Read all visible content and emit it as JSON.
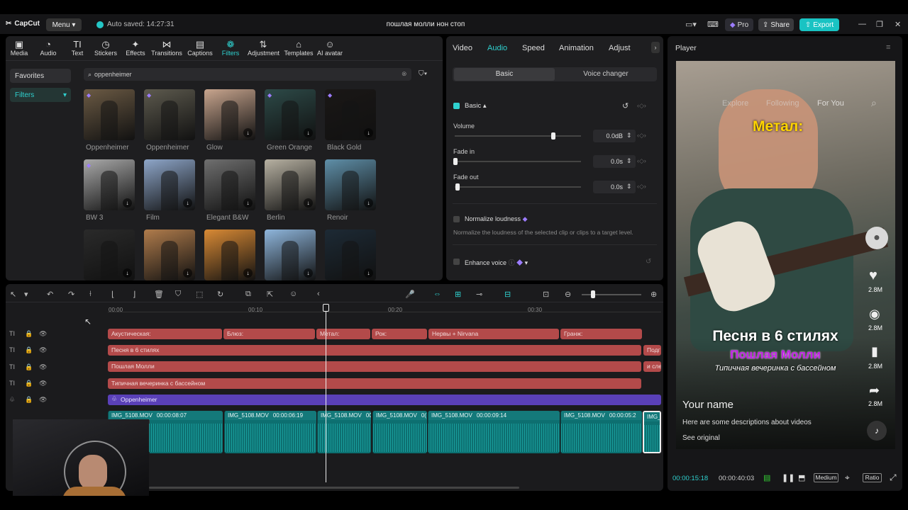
{
  "app": {
    "logo": "CapCut",
    "menu": "Menu",
    "autosave": "Auto saved: 14:27:31",
    "title": "пошлая молли нон стоп",
    "pro": "Pro",
    "share": "Share",
    "export": "Export"
  },
  "toolbar": [
    {
      "label": "Media",
      "icon": "▣"
    },
    {
      "label": "Audio",
      "icon": "◔"
    },
    {
      "label": "Text",
      "icon": "TI"
    },
    {
      "label": "Stickers",
      "icon": "◷"
    },
    {
      "label": "Effects",
      "icon": "✦"
    },
    {
      "label": "Transitions",
      "icon": "⋈"
    },
    {
      "label": "Captions",
      "icon": "▤"
    },
    {
      "label": "Filters",
      "icon": "❁"
    },
    {
      "label": "Adjustment",
      "icon": "⇅"
    },
    {
      "label": "Templates",
      "icon": "⌂"
    },
    {
      "label": "AI avatar",
      "icon": "☺"
    }
  ],
  "sidebar": {
    "favorites": "Favorites",
    "filters": "Filters"
  },
  "search": {
    "value": "oppenheimer"
  },
  "filters": [
    {
      "name": "Oppenheimer",
      "bg": "#6b5a44"
    },
    {
      "name": "Oppenheimer",
      "bg": "#5d5a4e"
    },
    {
      "name": "Glow",
      "bg": "#c8a58e"
    },
    {
      "name": "Green Orange",
      "bg": "#2d4a48"
    },
    {
      "name": "Black Gold",
      "bg": "#1a1716"
    },
    {
      "name": "BW 3",
      "bg": "#a9a9a9"
    },
    {
      "name": "Film",
      "bg": "#8ea6c9"
    },
    {
      "name": "Elegant B&W",
      "bg": "#6f6f6f"
    },
    {
      "name": "Berlin",
      "bg": "#b7b1a2"
    },
    {
      "name": "Renoir",
      "bg": "#5f8fa8"
    },
    {
      "name": "",
      "bg": "#2a2a2a"
    },
    {
      "name": "",
      "bg": "#b07c4c"
    },
    {
      "name": "",
      "bg": "#d98a35"
    },
    {
      "name": "",
      "bg": "#8fb6dc"
    },
    {
      "name": "",
      "bg": "#1d2a35"
    }
  ],
  "props": {
    "tabs": [
      "Video",
      "Audio",
      "Speed",
      "Animation",
      "Adjust"
    ],
    "subtabs": [
      "Basic",
      "Voice changer"
    ],
    "section": "Basic",
    "volume_label": "Volume",
    "volume_value": "0.0dB",
    "volume_level": 0.78,
    "fadein_label": "Fade in",
    "fadein_value": "0.0s",
    "fadeout_label": "Fade out",
    "fadeout_value": "0.0s",
    "normalize_label": "Normalize loudness",
    "normalize_desc": "Normalize the loudness of the selected clip or clips to a target level.",
    "enhance_label": "Enhance voice"
  },
  "timeline": {
    "ruler": [
      "00:00",
      "00:10",
      "00:20",
      "00:30"
    ],
    "row1": [
      "Акустическая:",
      "Блюз:",
      "Метал:",
      "Рок:",
      "Нервы + Nirvana",
      "Гранж:"
    ],
    "row2": "Песня в 6 стилях",
    "row2_tail": "Подг",
    "row3": "Пошлая Молли",
    "row3_tail": "и сле",
    "row4": "Типичная вечеринка с бассейном",
    "row5": "Oppenheimer",
    "video": [
      {
        "name": "IMG_5108.MOV",
        "dur": "00:00:08:07"
      },
      {
        "name": "IMG_5108.MOV",
        "dur": "00:00:06:19"
      },
      {
        "name": "IMG_5108.MOV",
        "dur": "00"
      },
      {
        "name": "IMG_5108.MOV",
        "dur": "0("
      },
      {
        "name": "IMG_5108.MOV",
        "dur": "00:00:09:14"
      },
      {
        "name": "IMG_5108.MOV",
        "dur": "00:00:05:2"
      },
      {
        "name": "IMG_",
        "dur": ""
      }
    ]
  },
  "player": {
    "title": "Player",
    "overlay_top": "Метал:",
    "nav": [
      "Explore",
      "Following",
      "For You"
    ],
    "big1": "Песня в 6 стилях",
    "big2": "Пошлая Молли",
    "big3": "Типичная вечеринка с бассейном",
    "your_name": "Your name",
    "desc": "Here are some descriptions about videos",
    "see": "See original",
    "counts": [
      "2.8M",
      "2.8M",
      "2.8M",
      "2.8M"
    ],
    "time_current": "00:00:15:18",
    "time_total": "00:00:40:03",
    "quality": "Medium",
    "ratio": "Ratio"
  }
}
